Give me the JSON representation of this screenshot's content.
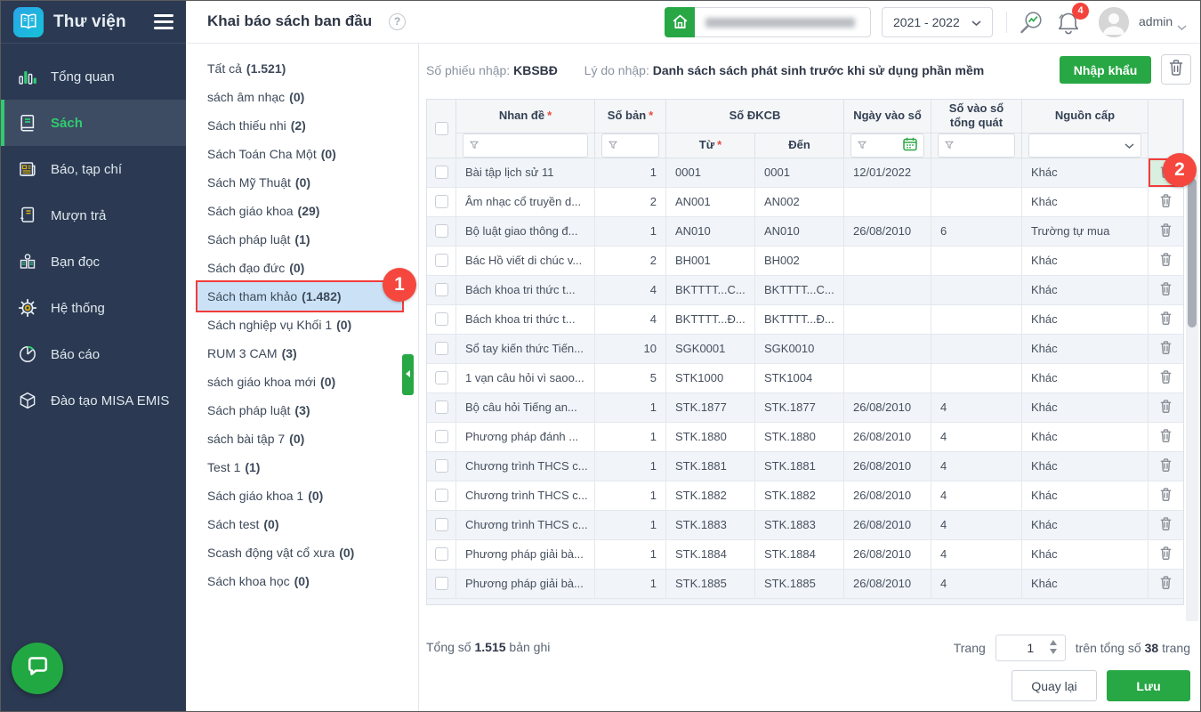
{
  "accent_colors": {
    "green": "#28a745",
    "sidebar_bg": "#2b3a52",
    "selected_category_bg": "#cbe2f6",
    "annotation_red": "#f5473d",
    "badge_red": "#f4433c"
  },
  "icons": {
    "logo": "open-book-icon",
    "menu": "hamburger-icon",
    "help": "question-circle-icon",
    "school": "house-icon",
    "search": "magnifier-trend-icon",
    "notifications": "bell-icon",
    "avatar": "person-silhouette-icon",
    "filter": "funnel-icon",
    "calendar": "calendar-icon",
    "delete": "trash-icon",
    "chat": "speech-bubble-icon",
    "collapse": "left-triangle-icon"
  },
  "sidebar": {
    "app_title": "Thư viện",
    "items": [
      {
        "label": "Tổng quan",
        "icon": "bar-chart-icon",
        "selected": false
      },
      {
        "label": "Sách",
        "icon": "book-icon",
        "selected": true
      },
      {
        "label": "Báo, tạp chí",
        "icon": "newspaper-icon",
        "selected": false
      },
      {
        "label": "Mượn trả",
        "icon": "borrow-return-book-icon",
        "selected": false
      },
      {
        "label": "Bạn đọc",
        "icon": "reader-icon",
        "selected": false
      },
      {
        "label": "Hệ thống",
        "icon": "gear-icon",
        "selected": false
      },
      {
        "label": "Báo cáo",
        "icon": "pie-chart-icon",
        "selected": false
      },
      {
        "label": "Đào tạo MISA EMIS",
        "icon": "cube-icon",
        "selected": false
      }
    ]
  },
  "topbar": {
    "page_title": "Khai báo sách ban đầu",
    "school_year": "2021 - 2022",
    "notification_count": "4",
    "username": "admin"
  },
  "categories": {
    "items": [
      {
        "label": "Tất cả",
        "count": "(1.521)",
        "selected": false
      },
      {
        "label": "sách âm nhạc",
        "count": "(0)",
        "selected": false
      },
      {
        "label": "Sách thiếu nhi",
        "count": "(2)",
        "selected": false
      },
      {
        "label": "Sách Toán Cha Một",
        "count": "(0)",
        "selected": false
      },
      {
        "label": "Sách Mỹ Thuật",
        "count": "(0)",
        "selected": false
      },
      {
        "label": "Sách giáo khoa",
        "count": "(29)",
        "selected": false
      },
      {
        "label": "Sách pháp luật",
        "count": "(1)",
        "selected": false
      },
      {
        "label": "Sách đạo đức",
        "count": "(0)",
        "selected": false
      },
      {
        "label": "Sách tham khảo",
        "count": "(1.482)",
        "selected": true
      },
      {
        "label": "Sách nghiệp vụ Khối 1",
        "count": "(0)",
        "selected": false
      },
      {
        "label": "RUM 3 CAM",
        "count": "(3)",
        "selected": false
      },
      {
        "label": "sách giáo khoa mới",
        "count": "(0)",
        "selected": false
      },
      {
        "label": "Sách pháp luật",
        "count": "(3)",
        "selected": false
      },
      {
        "label": "sách bài tập 7",
        "count": "(0)",
        "selected": false
      },
      {
        "label": "Test 1",
        "count": "(1)",
        "selected": false
      },
      {
        "label": "Sách giáo khoa 1",
        "count": "(0)",
        "selected": false
      },
      {
        "label": "Sách test",
        "count": "(0)",
        "selected": false
      },
      {
        "label": "Scash động vật cổ xưa",
        "count": "(0)",
        "selected": false
      },
      {
        "label": "Sách khoa học",
        "count": "(0)",
        "selected": false
      }
    ]
  },
  "toolbar": {
    "receipt_label": "Số phiếu nhập:",
    "receipt_value": "KBSBĐ",
    "reason_label": "Lý do nhập:",
    "reason_value": "Danh sách sách phát sinh trước khi sử dụng phần mềm",
    "import_button": "Nhập khẩu"
  },
  "table": {
    "cols": {
      "title": "Nhan đề",
      "copies": "Số bản",
      "dkcb_group": "Số ĐKCB",
      "from": "Từ",
      "to": "Đến",
      "date": "Ngày vào sổ",
      "ledger": "Số vào sổ tổng quát",
      "source": "Nguồn cấp",
      "required_mark": "*"
    },
    "rows": [
      {
        "title": "Bài tập lịch sử 11",
        "copies": "1",
        "from": "0001",
        "to": "0001",
        "date": "12/01/2022",
        "ledger": "",
        "source": "Khác",
        "trash_highlight": true
      },
      {
        "title": "Âm nhạc cổ truyền d...",
        "copies": "2",
        "from": "AN001",
        "to": "AN002",
        "date": "",
        "ledger": "",
        "source": "Khác",
        "trash_highlight": false
      },
      {
        "title": "Bộ luật giao thông đ...",
        "copies": "1",
        "from": "AN010",
        "to": "AN010",
        "date": "26/08/2010",
        "ledger": "6",
        "source": "Trường tự mua",
        "trash_highlight": false
      },
      {
        "title": "Bác Hồ viết di chúc v...",
        "copies": "2",
        "from": "BH001",
        "to": "BH002",
        "date": "",
        "ledger": "",
        "source": "Khác",
        "trash_highlight": false
      },
      {
        "title": "Bách khoa tri thức t...",
        "copies": "4",
        "from": "BKTTTT...C...",
        "to": "BKTTTT...C...",
        "date": "",
        "ledger": "",
        "source": "Khác",
        "trash_highlight": false
      },
      {
        "title": "Bách khoa tri thức t...",
        "copies": "4",
        "from": "BKTTTT...Đ...",
        "to": "BKTTTT...Đ...",
        "date": "",
        "ledger": "",
        "source": "Khác",
        "trash_highlight": false
      },
      {
        "title": "Sổ tay kiến thức Tiến...",
        "copies": "10",
        "from": "SGK0001",
        "to": "SGK0010",
        "date": "",
        "ledger": "",
        "source": "Khác",
        "trash_highlight": false
      },
      {
        "title": "1 vạn câu hỏi vì saoo...",
        "copies": "5",
        "from": "STK1000",
        "to": "STK1004",
        "date": "",
        "ledger": "",
        "source": "Khác",
        "trash_highlight": false
      },
      {
        "title": "Bộ câu hỏi Tiếng an...",
        "copies": "1",
        "from": "STK.1877",
        "to": "STK.1877",
        "date": "26/08/2010",
        "ledger": "4",
        "source": "Khác",
        "trash_highlight": false
      },
      {
        "title": "Phương pháp đánh ...",
        "copies": "1",
        "from": "STK.1880",
        "to": "STK.1880",
        "date": "26/08/2010",
        "ledger": "4",
        "source": "Khác",
        "trash_highlight": false
      },
      {
        "title": "Chương trình THCS c...",
        "copies": "1",
        "from": "STK.1881",
        "to": "STK.1881",
        "date": "26/08/2010",
        "ledger": "4",
        "source": "Khác",
        "trash_highlight": false
      },
      {
        "title": "Chương trình THCS c...",
        "copies": "1",
        "from": "STK.1882",
        "to": "STK.1882",
        "date": "26/08/2010",
        "ledger": "4",
        "source": "Khác",
        "trash_highlight": false
      },
      {
        "title": "Chương trình THCS c...",
        "copies": "1",
        "from": "STK.1883",
        "to": "STK.1883",
        "date": "26/08/2010",
        "ledger": "4",
        "source": "Khác",
        "trash_highlight": false
      },
      {
        "title": "Phương pháp giải bà...",
        "copies": "1",
        "from": "STK.1884",
        "to": "STK.1884",
        "date": "26/08/2010",
        "ledger": "4",
        "source": "Khác",
        "trash_highlight": false
      },
      {
        "title": "Phương pháp giải bà...",
        "copies": "1",
        "from": "STK.1885",
        "to": "STK.1885",
        "date": "26/08/2010",
        "ledger": "4",
        "source": "Khác",
        "trash_highlight": false
      }
    ]
  },
  "footer": {
    "total_prefix": "Tổng số",
    "total_value": "1.515",
    "total_suffix": "bản ghi",
    "page_label": "Trang",
    "page_value": "1",
    "page_total_prefix": "trên tổng số",
    "page_total_value": "38",
    "page_total_suffix": "trang",
    "back_button": "Quay lại",
    "save_button": "Lưu"
  },
  "annotations": {
    "step1": "1",
    "step2": "2"
  }
}
